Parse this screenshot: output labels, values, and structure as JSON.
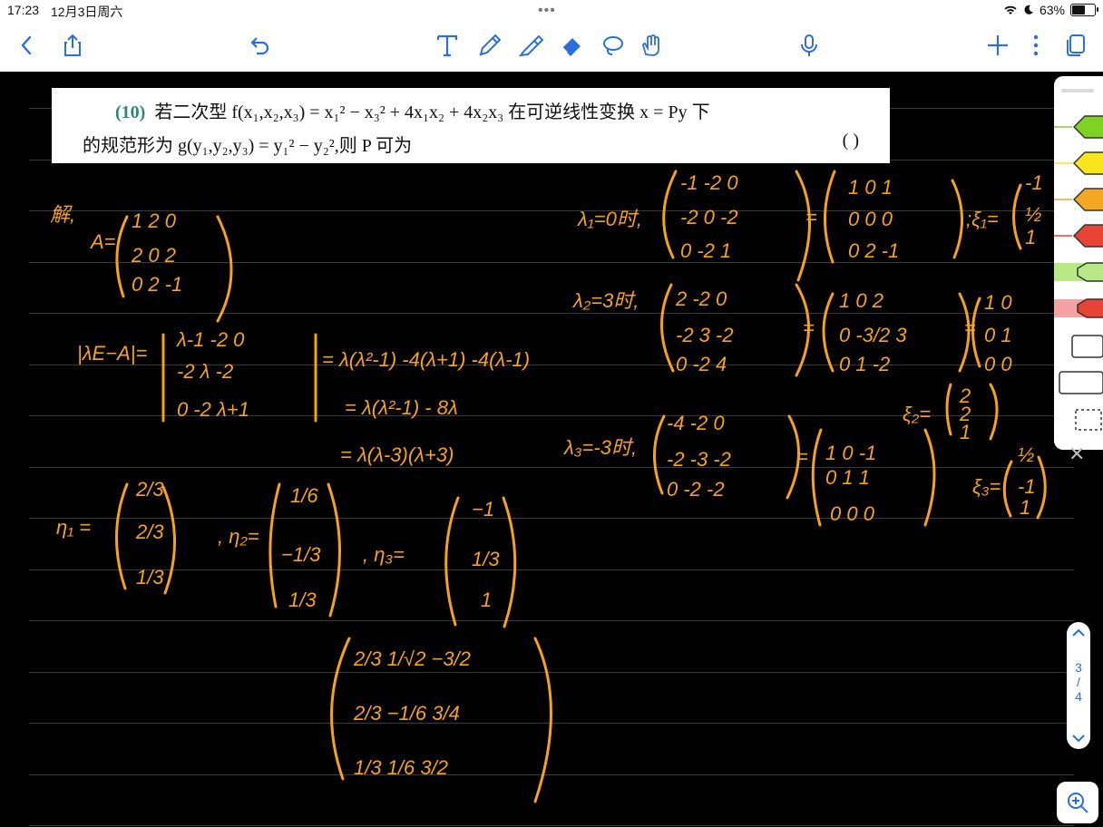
{
  "status": {
    "time": "17:23",
    "date": "12月3日周六",
    "battery": "63%"
  },
  "toolbar": {
    "icons": [
      "back-icon",
      "share-icon",
      "undo-icon",
      "text-tool-icon",
      "pen-tool-icon",
      "highlighter-icon",
      "eraser-icon",
      "lasso-icon",
      "hand-icon",
      "mic-icon",
      "add-icon",
      "more-icon",
      "pages-icon"
    ]
  },
  "question": {
    "number": "(10)",
    "line1": "若二次型 f(x₁,x₂,x₃) = x₁² − x₃² + 4x₁x₂ + 4x₂x₃ 在可逆线性变换 x = Py 下",
    "line2": "的规范形为 g(y₁,y₂,y₃) = y₁² − y₂²,则 P 可为",
    "paren": "(        )"
  },
  "palette": {
    "colors": [
      "#7ed321",
      "#f8e71c",
      "#f5a623",
      "#e94335",
      "#b8e986",
      "#f4a3a3"
    ]
  },
  "pager": {
    "current": "3",
    "separator": "/",
    "total": "4"
  },
  "colors": {
    "ink": "#f7a21b",
    "accent": "#2b6fde"
  }
}
